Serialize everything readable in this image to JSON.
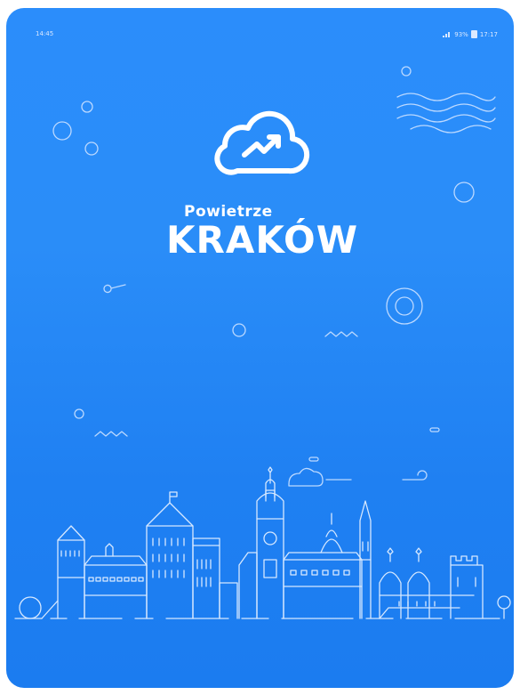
{
  "status_bar": {
    "time_left": "14:45",
    "battery_percent": "93%",
    "time_right": "17:17"
  },
  "splash": {
    "subtitle": "Powietrze",
    "title": "KRAKÓW"
  },
  "icons": {
    "logo": "cloud-chart-icon",
    "skyline": "krakow-skyline-illustration",
    "signal": "signal-icon",
    "battery": "battery-icon"
  },
  "colors": {
    "background_top": "#2b8dfb",
    "background_bottom": "#1b7cf0",
    "foreground": "#ffffff"
  }
}
